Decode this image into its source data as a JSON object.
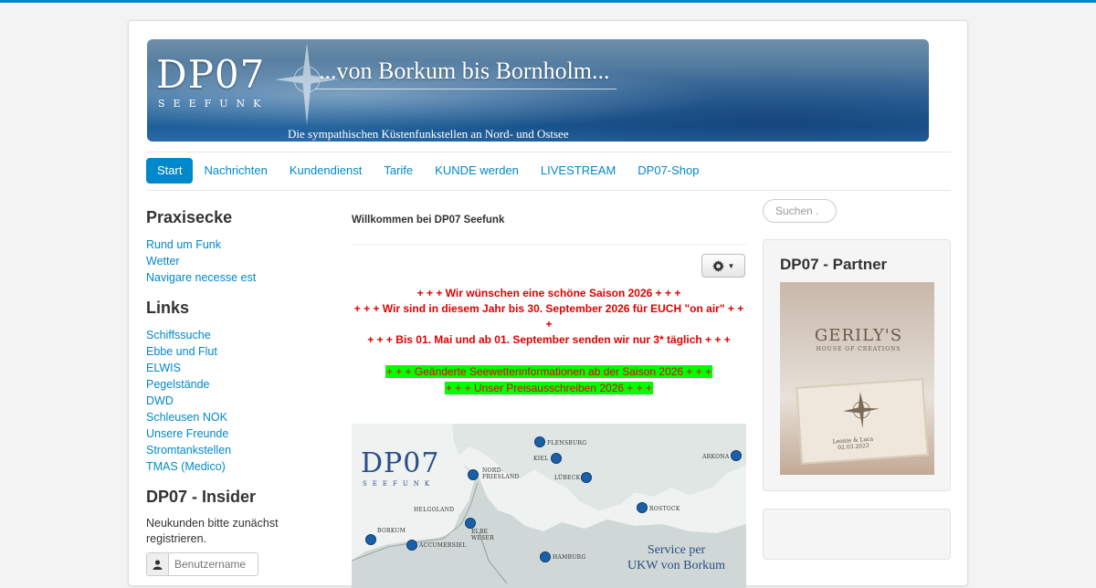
{
  "banner": {
    "logo": "DP07",
    "logo_sub": "SEEFUNK",
    "tagline": "...von Borkum bis Bornholm...",
    "sub_tagline": "Die sympathischen Küstenfunkstellen an Nord- und Ostsee"
  },
  "nav": {
    "items": [
      {
        "label": "Start",
        "active": true
      },
      {
        "label": "Nachrichten"
      },
      {
        "label": "Kundendienst"
      },
      {
        "label": "Tarife"
      },
      {
        "label": "KUNDE werden"
      },
      {
        "label": "LIVESTREAM"
      },
      {
        "label": "DP07-Shop"
      }
    ]
  },
  "sidebar": {
    "praxisecke_title": "Praxisecke",
    "praxisecke": [
      "Rund um Funk",
      "Wetter",
      "Navigare necesse est"
    ],
    "links_title": "Links",
    "links": [
      "Schiffssuche",
      "Ebbe und Flut",
      "ELWIS",
      "Pegelstände",
      "DWD",
      "Schleusen NOK",
      "Unsere Freunde",
      "Stromtankstellen",
      "TMAS (Medico)"
    ],
    "insider_title": "DP07 - Insider",
    "insider_text": "Neukunden bitte zunächst registrieren.",
    "username_placeholder": "Benutzername"
  },
  "main": {
    "title": "Willkommen bei DP07 Seefunk",
    "line1": "+ + +   Wir wünschen  eine schöne Saison 2026 + + +",
    "line2": "+ + + Wir sind in diesem Jahr  bis 30. September 2026 für EUCH \"on air\" + + +",
    "line3": "+ + + Bis 01. Mai  und ab 01. September senden wir nur 3* täglich + + +",
    "green1": "+ + + Geänderte Seewetterinformationen ab der Saison 2026 + + +",
    "green2": "+ + + Unser Preisausschreiben 2026 + + +",
    "map": {
      "logo": "DP07",
      "logo_sub": "SEEFUNK",
      "service": "Service per",
      "service2": "UKW von Borkum",
      "labels": {
        "flensburg": "FLENSBURG",
        "kiel": "KIEL",
        "nordfriesland": "NORD-",
        "nordfriesland2": "FRIESLAND",
        "luebeck": "LÜBECK",
        "arkona": "ARKONA",
        "rostock": "ROSTOCK",
        "helgoland": "HELGOLAND",
        "elbe": "ELBE",
        "weser": "WESER",
        "borkum": "BORKUM",
        "accumersiel": "ACCUMERSIEL",
        "hamburg": "HAMBURG"
      }
    }
  },
  "right": {
    "search_placeholder": "Suchen .",
    "partner_title": "DP07 - Partner",
    "partner_brand": "GERILY'S",
    "partner_brand_sub": "HOUSE OF CREATIONS",
    "partner_names": "Leonie & Luca",
    "partner_date": "02.03.2023"
  },
  "colors": {
    "accent": "#0088cc",
    "notice_red": "#e00000",
    "highlight_green": "#00ff00",
    "map_dot": "#1b5fa6"
  }
}
